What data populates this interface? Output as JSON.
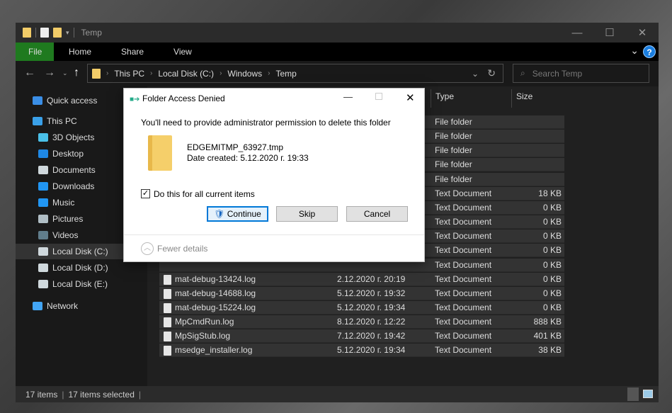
{
  "window": {
    "title": "Temp",
    "minimize": "—",
    "maximize": "☐",
    "close": "✕"
  },
  "ribbon": {
    "tabs": [
      "File",
      "Home",
      "Share",
      "View"
    ],
    "help": "?",
    "expand": "⌄"
  },
  "address": {
    "crumbs": [
      "This PC",
      "Local Disk (C:)",
      "Windows",
      "Temp"
    ],
    "search_placeholder": "Search Temp"
  },
  "sidebar": {
    "items": [
      {
        "label": "Quick access",
        "icon": "star-icon",
        "color": "#3a8ee6"
      },
      {
        "label": "This PC",
        "icon": "computer-icon",
        "color": "#3aa0e8"
      },
      {
        "label": "3D Objects",
        "icon": "cube-icon",
        "color": "#4ac0e8"
      },
      {
        "label": "Desktop",
        "icon": "desktop-icon",
        "color": "#1e88e5"
      },
      {
        "label": "Documents",
        "icon": "document-icon",
        "color": "#cfd8dc"
      },
      {
        "label": "Downloads",
        "icon": "download-icon",
        "color": "#2196f3"
      },
      {
        "label": "Music",
        "icon": "music-icon",
        "color": "#2196f3"
      },
      {
        "label": "Pictures",
        "icon": "pictures-icon",
        "color": "#b0bec5"
      },
      {
        "label": "Videos",
        "icon": "videos-icon",
        "color": "#607d8b"
      },
      {
        "label": "Local Disk (C:)",
        "icon": "drive-icon",
        "color": "#cfd8dc",
        "selected": true
      },
      {
        "label": "Local Disk (D:)",
        "icon": "drive-icon",
        "color": "#cfd8dc"
      },
      {
        "label": "Local Disk (E:)",
        "icon": "drive-icon",
        "color": "#cfd8dc"
      },
      {
        "label": "Network",
        "icon": "network-icon",
        "color": "#42a5f5"
      }
    ]
  },
  "columns": {
    "type": "Type",
    "size": "Size"
  },
  "files": [
    {
      "name": "",
      "date": "",
      "type": "File folder",
      "size": ""
    },
    {
      "name": "",
      "date": "",
      "type": "File folder",
      "size": ""
    },
    {
      "name": "",
      "date": "",
      "type": "File folder",
      "size": ""
    },
    {
      "name": "",
      "date": "",
      "type": "File folder",
      "size": ""
    },
    {
      "name": "",
      "date": "",
      "type": "File folder",
      "size": ""
    },
    {
      "name": "",
      "date": "",
      "type": "Text Document",
      "size": "18 KB"
    },
    {
      "name": "",
      "date": "",
      "type": "Text Document",
      "size": "0 KB"
    },
    {
      "name": "",
      "date": "",
      "type": "Text Document",
      "size": "0 KB"
    },
    {
      "name": "",
      "date": "",
      "type": "Text Document",
      "size": "0 KB"
    },
    {
      "name": "",
      "date": "",
      "type": "Text Document",
      "size": "0 KB"
    },
    {
      "name": "",
      "date": "",
      "type": "Text Document",
      "size": "0 KB"
    },
    {
      "name": "mat-debug-13424.log",
      "date": "2.12.2020 г. 20:19",
      "type": "Text Document",
      "size": "0 KB"
    },
    {
      "name": "mat-debug-14688.log",
      "date": "5.12.2020 г. 19:32",
      "type": "Text Document",
      "size": "0 KB"
    },
    {
      "name": "mat-debug-15224.log",
      "date": "5.12.2020 г. 19:34",
      "type": "Text Document",
      "size": "0 KB"
    },
    {
      "name": "MpCmdRun.log",
      "date": "8.12.2020 г. 12:22",
      "type": "Text Document",
      "size": "888 KB"
    },
    {
      "name": "MpSigStub.log",
      "date": "7.12.2020 г. 19:42",
      "type": "Text Document",
      "size": "401 KB"
    },
    {
      "name": "msedge_installer.log",
      "date": "5.12.2020 г. 19:34",
      "type": "Text Document",
      "size": "38 KB"
    }
  ],
  "status": {
    "items": "17 items",
    "selected": "17 items selected"
  },
  "dialog": {
    "title": "Folder Access Denied",
    "message": "You'll need to provide administrator permission to delete this folder",
    "file_name": "EDGEMITMP_63927.tmp",
    "date_created": "Date created: 5.12.2020 г. 19:33",
    "checkbox_label": "Do this for all current items",
    "checkbox_checked": true,
    "continue": "Continue",
    "skip": "Skip",
    "cancel": "Cancel",
    "fewer_details": "Fewer details",
    "close": "✕",
    "minimize": "—"
  }
}
